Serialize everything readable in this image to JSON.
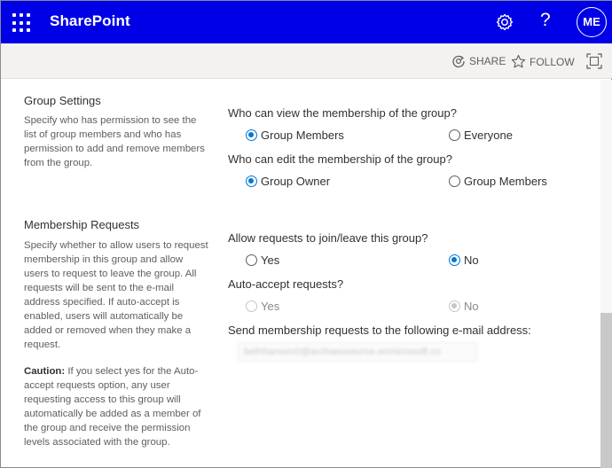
{
  "suitebar": {
    "brand": "SharePoint",
    "help_glyph": "?",
    "avatar_initials": "ME",
    "bg_color": "#0000e6"
  },
  "commands": {
    "share": "SHARE",
    "follow": "FOLLOW"
  },
  "group_settings": {
    "title": "Group Settings",
    "description": "Specify who has permission to see the list of group members and who has permission to add and remove members from the group.",
    "view_question": "Who can view the membership of the group?",
    "view_options": [
      {
        "label": "Group Members",
        "checked": true
      },
      {
        "label": "Everyone",
        "checked": false
      }
    ],
    "edit_question": "Who can edit the membership of the group?",
    "edit_options": [
      {
        "label": "Group Owner",
        "checked": true
      },
      {
        "label": "Group Members",
        "checked": false
      }
    ]
  },
  "membership_requests": {
    "title": "Membership Requests",
    "description": "Specify whether to allow users to request membership in this group and allow users to request to leave the group. All requests will be sent to the e-mail address specified. If auto-accept is enabled, users will automatically be added or removed when they make a request.",
    "caution_label": "Caution:",
    "caution_text": " If you select yes for the Auto-accept requests option, any user requesting access to this group will automatically be added as a member of the group and receive the permission levels associated with the group.",
    "allow_question": "Allow requests to join/leave this group?",
    "allow_options": [
      {
        "label": "Yes",
        "checked": false
      },
      {
        "label": "No",
        "checked": true
      }
    ],
    "auto_question": "Auto-accept requests?",
    "auto_options": [
      {
        "label": "Yes",
        "checked": false,
        "disabled": true
      },
      {
        "label": "No",
        "checked": true,
        "disabled": true
      }
    ],
    "email_question": "Send membership requests to the following e-mail address:",
    "email_value": "bethhanson0@archaeosource.onmicrosoft.co"
  },
  "accent_color": "#0078d4"
}
